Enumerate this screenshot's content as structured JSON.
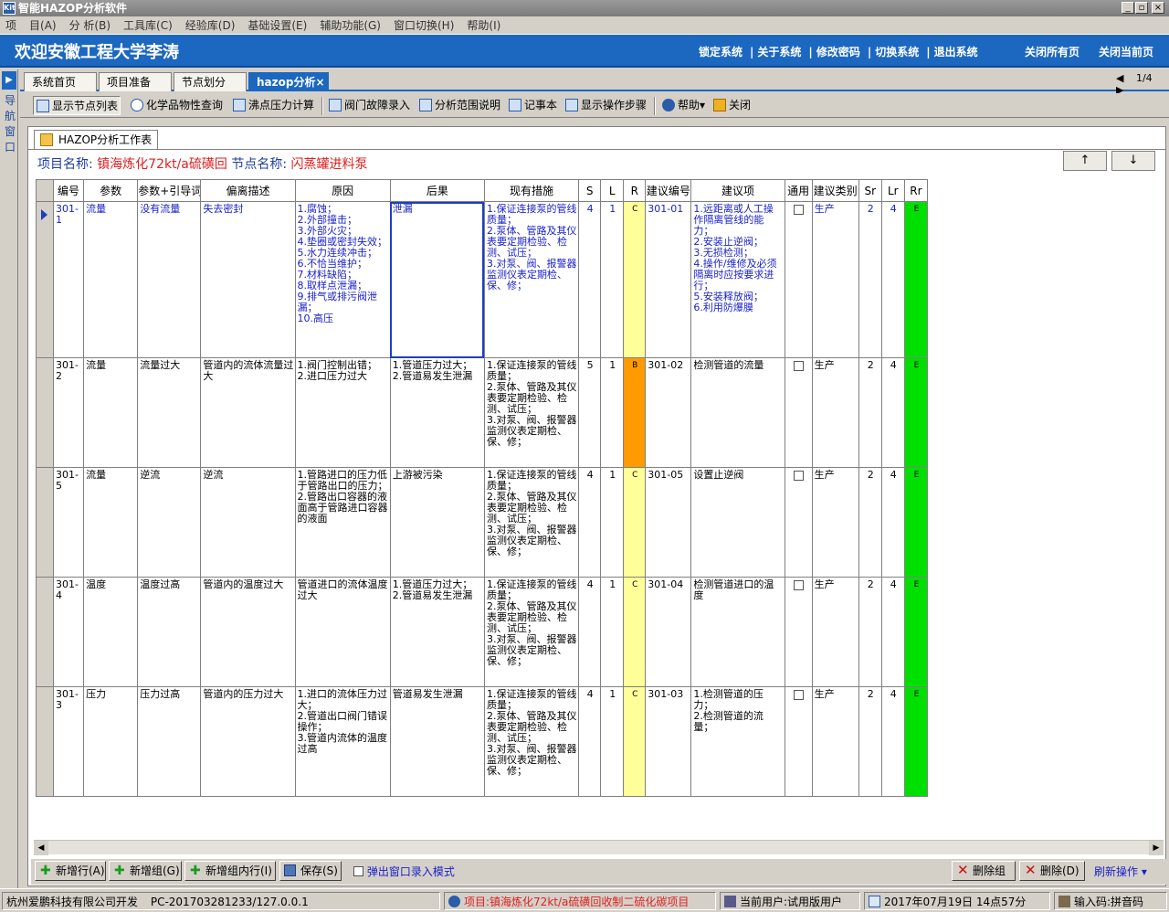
{
  "window": {
    "title": "智能HAZOP分析软件",
    "min": "_",
    "max": "▫",
    "close": "×"
  },
  "menu": [
    "项",
    "目(A)",
    "分 析(B)",
    "工具库(C)",
    "经验库(D)",
    "基础设置(E)",
    "辅助功能(G)",
    "窗口切换(H)",
    "帮助(I)"
  ],
  "banner": {
    "welcome": "欢迎安徽工程大学李涛",
    "links": [
      "锁定系统",
      "关于系统",
      "修改密码",
      "切换系统",
      "退出系统"
    ],
    "close_all": "关闭所有页",
    "close_current": "关闭当前页"
  },
  "left_nav": {
    "text": "导航窗口"
  },
  "tabs": [
    "系统首页",
    "项目准备",
    "节点划分",
    "hazop分析×"
  ],
  "pager": {
    "prev": "◀",
    "page": "1/4",
    "next": "▶"
  },
  "toolbar": [
    "显示节点列表",
    "化学品物性查询",
    "沸点压力计算",
    "阀门故障录入",
    "分析范围说明",
    "记事本",
    "显示操作步骤",
    "帮助▾",
    "关闭"
  ],
  "worksheet_tab": "HAZOP分析工作表",
  "info": {
    "project_label": "项目名称:",
    "project_value": "镇海炼化72kt/a硫磺回",
    "node_label": "节点名称:",
    "node_value": "闪蒸罐进料泵"
  },
  "nav_buttons": {
    "up": "↑",
    "down": "↓"
  },
  "table": {
    "headers": [
      "编号",
      "参数",
      "参数+引导词",
      "偏离描述",
      "原因",
      "后果",
      "现有措施",
      "S",
      "L",
      "R",
      "建议编号",
      "建议项",
      "通用",
      "建议类别",
      "Sr",
      "Lr",
      "Rr"
    ],
    "rows": [
      {
        "id": "301-1",
        "param": "流量",
        "guide": "没有流量",
        "deviation": "失去密封",
        "cause": "1.腐蚀；\n2.外部撞击；\n3.外部火灾；\n4.垫圈或密封失效；\n5.水力连续冲击；\n6.不恰当维护；\n7.材料缺陷；\n8.取样点泄漏；\n9.排气或排污阀泄漏；\n10.高压",
        "consequence": "泄漏",
        "measures": "1.保证连接泵的管线质量；\n2.泵体、管路及其仪表要定期检验、检测、试压；\n3.对泵、阀、报警器监测仪表定期检、保、修；",
        "s": "4",
        "l": "1",
        "r": "C",
        "rec_id": "301-01",
        "rec": "1.远距离或人工操作隔离管线的能力；\n2.安装止逆阀；\n3.无损检测；\n4.操作/维修及必须隔离时应按要求进行；\n5.安装释放阀；\n6.利用防爆膜",
        "category": "生产",
        "sr": "2",
        "lr": "4",
        "rr": "E",
        "blue": true
      },
      {
        "id": "301-2",
        "param": "流量",
        "guide": "流量过大",
        "deviation": "管道内的流体流量过大",
        "cause": "1.阀门控制出错；\n2.进口压力过大",
        "consequence": "1.管道压力过大；\n2.管道易发生泄漏",
        "measures": "1.保证连接泵的管线质量；\n2.泵体、管路及其仪表要定期检验、检测、试压；\n3.对泵、阀、报警器监测仪表定期检、保、修；",
        "s": "5",
        "l": "1",
        "r": "B",
        "rec_id": "301-02",
        "rec": "检测管道的流量",
        "category": "生产",
        "sr": "2",
        "lr": "4",
        "rr": "E",
        "blue": false
      },
      {
        "id": "301-5",
        "param": "流量",
        "guide": "逆流",
        "deviation": "逆流",
        "cause": "1.管路进口的压力低于管路出口的压力；\n2.管路出口容器的液面高于管路进口容器的液面",
        "consequence": "上游被污染",
        "measures": "1.保证连接泵的管线质量；\n2.泵体、管路及其仪表要定期检验、检测、试压；\n3.对泵、阀、报警器监测仪表定期检、保、修；",
        "s": "4",
        "l": "1",
        "r": "C",
        "rec_id": "301-05",
        "rec": "设置止逆阀",
        "category": "生产",
        "sr": "2",
        "lr": "4",
        "rr": "E",
        "blue": false
      },
      {
        "id": "301-4",
        "param": "温度",
        "guide": "温度过高",
        "deviation": "管道内的温度过大",
        "cause": "管道进口的流体温度过大",
        "consequence": "1.管道压力过大；\n2.管道易发生泄漏",
        "measures": "1.保证连接泵的管线质量；\n2.泵体、管路及其仪表要定期检验、检测、试压；\n3.对泵、阀、报警器监测仪表定期检、保、修；",
        "s": "4",
        "l": "1",
        "r": "C",
        "rec_id": "301-04",
        "rec": "检测管道进口的温度",
        "category": "生产",
        "sr": "2",
        "lr": "4",
        "rr": "E",
        "blue": false
      },
      {
        "id": "301-3",
        "param": "压力",
        "guide": "压力过高",
        "deviation": "管道内的压力过大",
        "cause": "1.进口的流体压力过大；\n2.管道出口阀门错误操作；\n3.管道内流体的温度过高",
        "consequence": "管道易发生泄漏",
        "measures": "1.保证连接泵的管线质量；\n2.泵体、管路及其仪表要定期检验、检测、试压；\n3.对泵、阀、报警器监测仪表定期检、保、修；",
        "s": "4",
        "l": "1",
        "r": "C",
        "rec_id": "301-03",
        "rec": "1.检测管道的压力；\n2.检测管道的流量；",
        "category": "生产",
        "sr": "2",
        "lr": "4",
        "rr": "E",
        "blue": false
      }
    ]
  },
  "risk_colors": {
    "B": "#ff9a00",
    "C": "#ffff99",
    "E": "#00e000"
  },
  "bottom": {
    "add_row": "新增行(A)",
    "add_group": "新增组(G)",
    "add_group_row": "新增组内行(I)",
    "save": "保存(S)",
    "popup_mode": "弹出窗口录入模式",
    "delete_group": "删除组",
    "delete": "删除(D)",
    "refresh": "刷新操作 ▾"
  },
  "status": {
    "company": "杭州爱鹏科技有限公司开发",
    "pc": "PC-201703281233/127.0.0.1",
    "project": "项目:镇海炼化72kt/a硫磺回收制二硫化碳项目",
    "user": "当前用户:试用版用户",
    "datetime": "2017年07月19日 14点57分",
    "ime": "输入码:拼音码"
  }
}
